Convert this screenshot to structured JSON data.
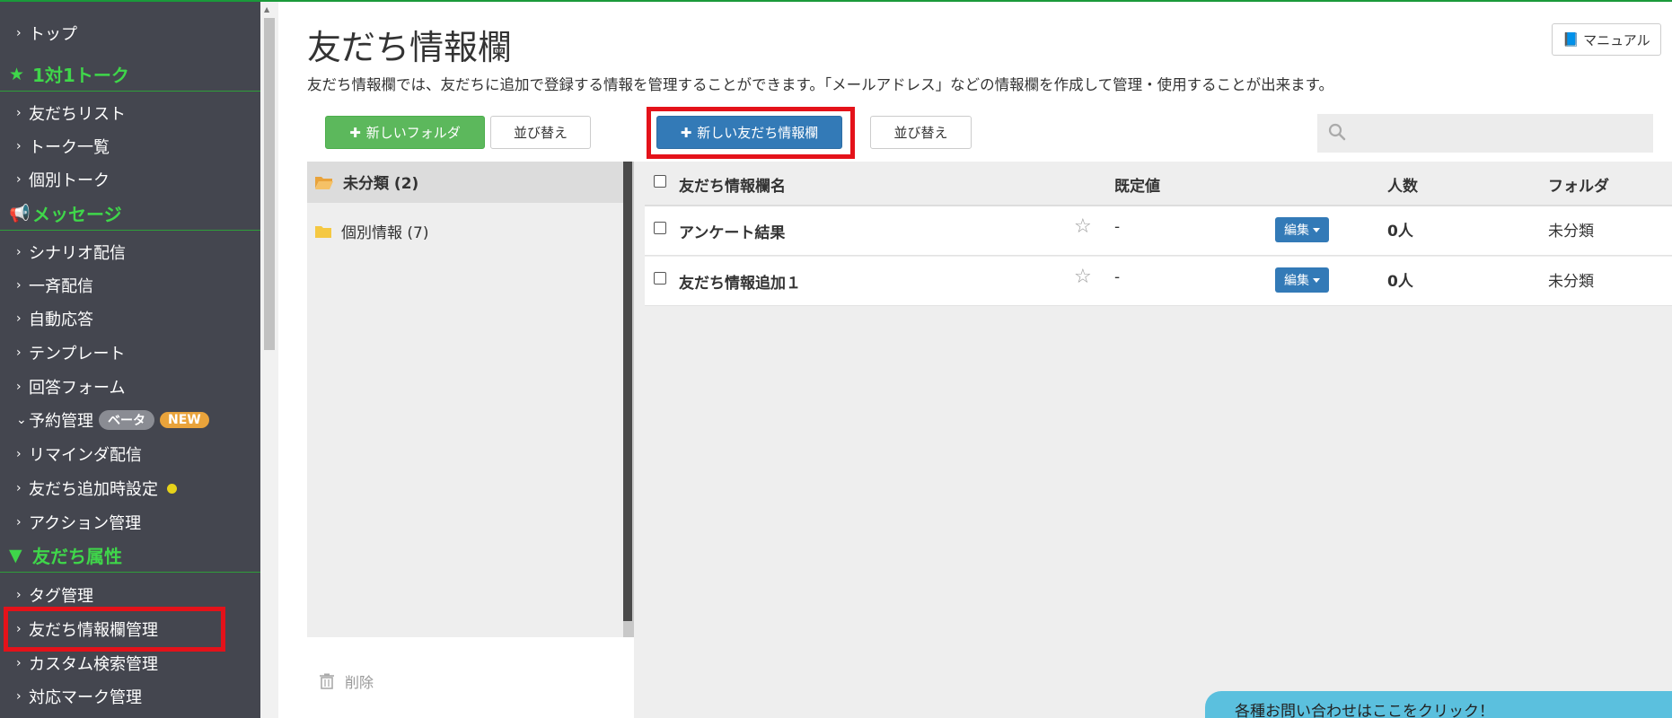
{
  "sidebar": {
    "top": "トップ",
    "sections": {
      "talk": "1対1トーク",
      "message": "メッセージ",
      "attribute": "友だち属性"
    },
    "talk_items": [
      "友だちリスト",
      "トーク一覧",
      "個別トーク"
    ],
    "message_items": [
      "シナリオ配信",
      "一斉配信",
      "自動応答",
      "テンプレート",
      "回答フォーム"
    ],
    "reservation": {
      "label": "予約管理",
      "beta": "ベータ",
      "new": "NEW"
    },
    "message_items2": [
      "リマインダ配信",
      "友だち追加時設定",
      "アクション管理"
    ],
    "attribute_items": [
      "タグ管理",
      "友だち情報欄管理",
      "カスタム検索管理",
      "対応マーク管理"
    ]
  },
  "header": {
    "title": "友だち情報欄",
    "manual_label": "マニュアル",
    "description": "友だち情報欄では、友だちに追加で登録する情報を管理することができます。「メールアドレス」などの情報欄を作成して管理・使用することが出来ます。"
  },
  "toolbar": {
    "new_folder": "新しいフォルダ",
    "sort1": "並び替え",
    "new_info": "新しい友だち情報欄",
    "sort2": "並び替え",
    "search_placeholder": ""
  },
  "folders": [
    {
      "name": "未分類 (2)",
      "selected": true
    },
    {
      "name": "個別情報 (7)",
      "selected": false
    }
  ],
  "delete_label": "削除",
  "table": {
    "columns": [
      "友だち情報欄名",
      "既定値",
      "人数",
      "フォルダ"
    ],
    "rows": [
      {
        "name": "アンケート結果",
        "default": "-",
        "edit": "編集",
        "count": "0人",
        "folder": "未分類"
      },
      {
        "name": "友だち情報追加１",
        "default": "-",
        "edit": "編集",
        "count": "0人",
        "folder": "未分類"
      }
    ]
  },
  "contact_bar": "各種お問い合わせはここをクリック！",
  "colors": {
    "sidebar_bg": "#44464f",
    "section_green": "#3fd64a",
    "primary_blue": "#337ab7",
    "success_green": "#5cb85c",
    "highlight_red": "#e4121a"
  }
}
